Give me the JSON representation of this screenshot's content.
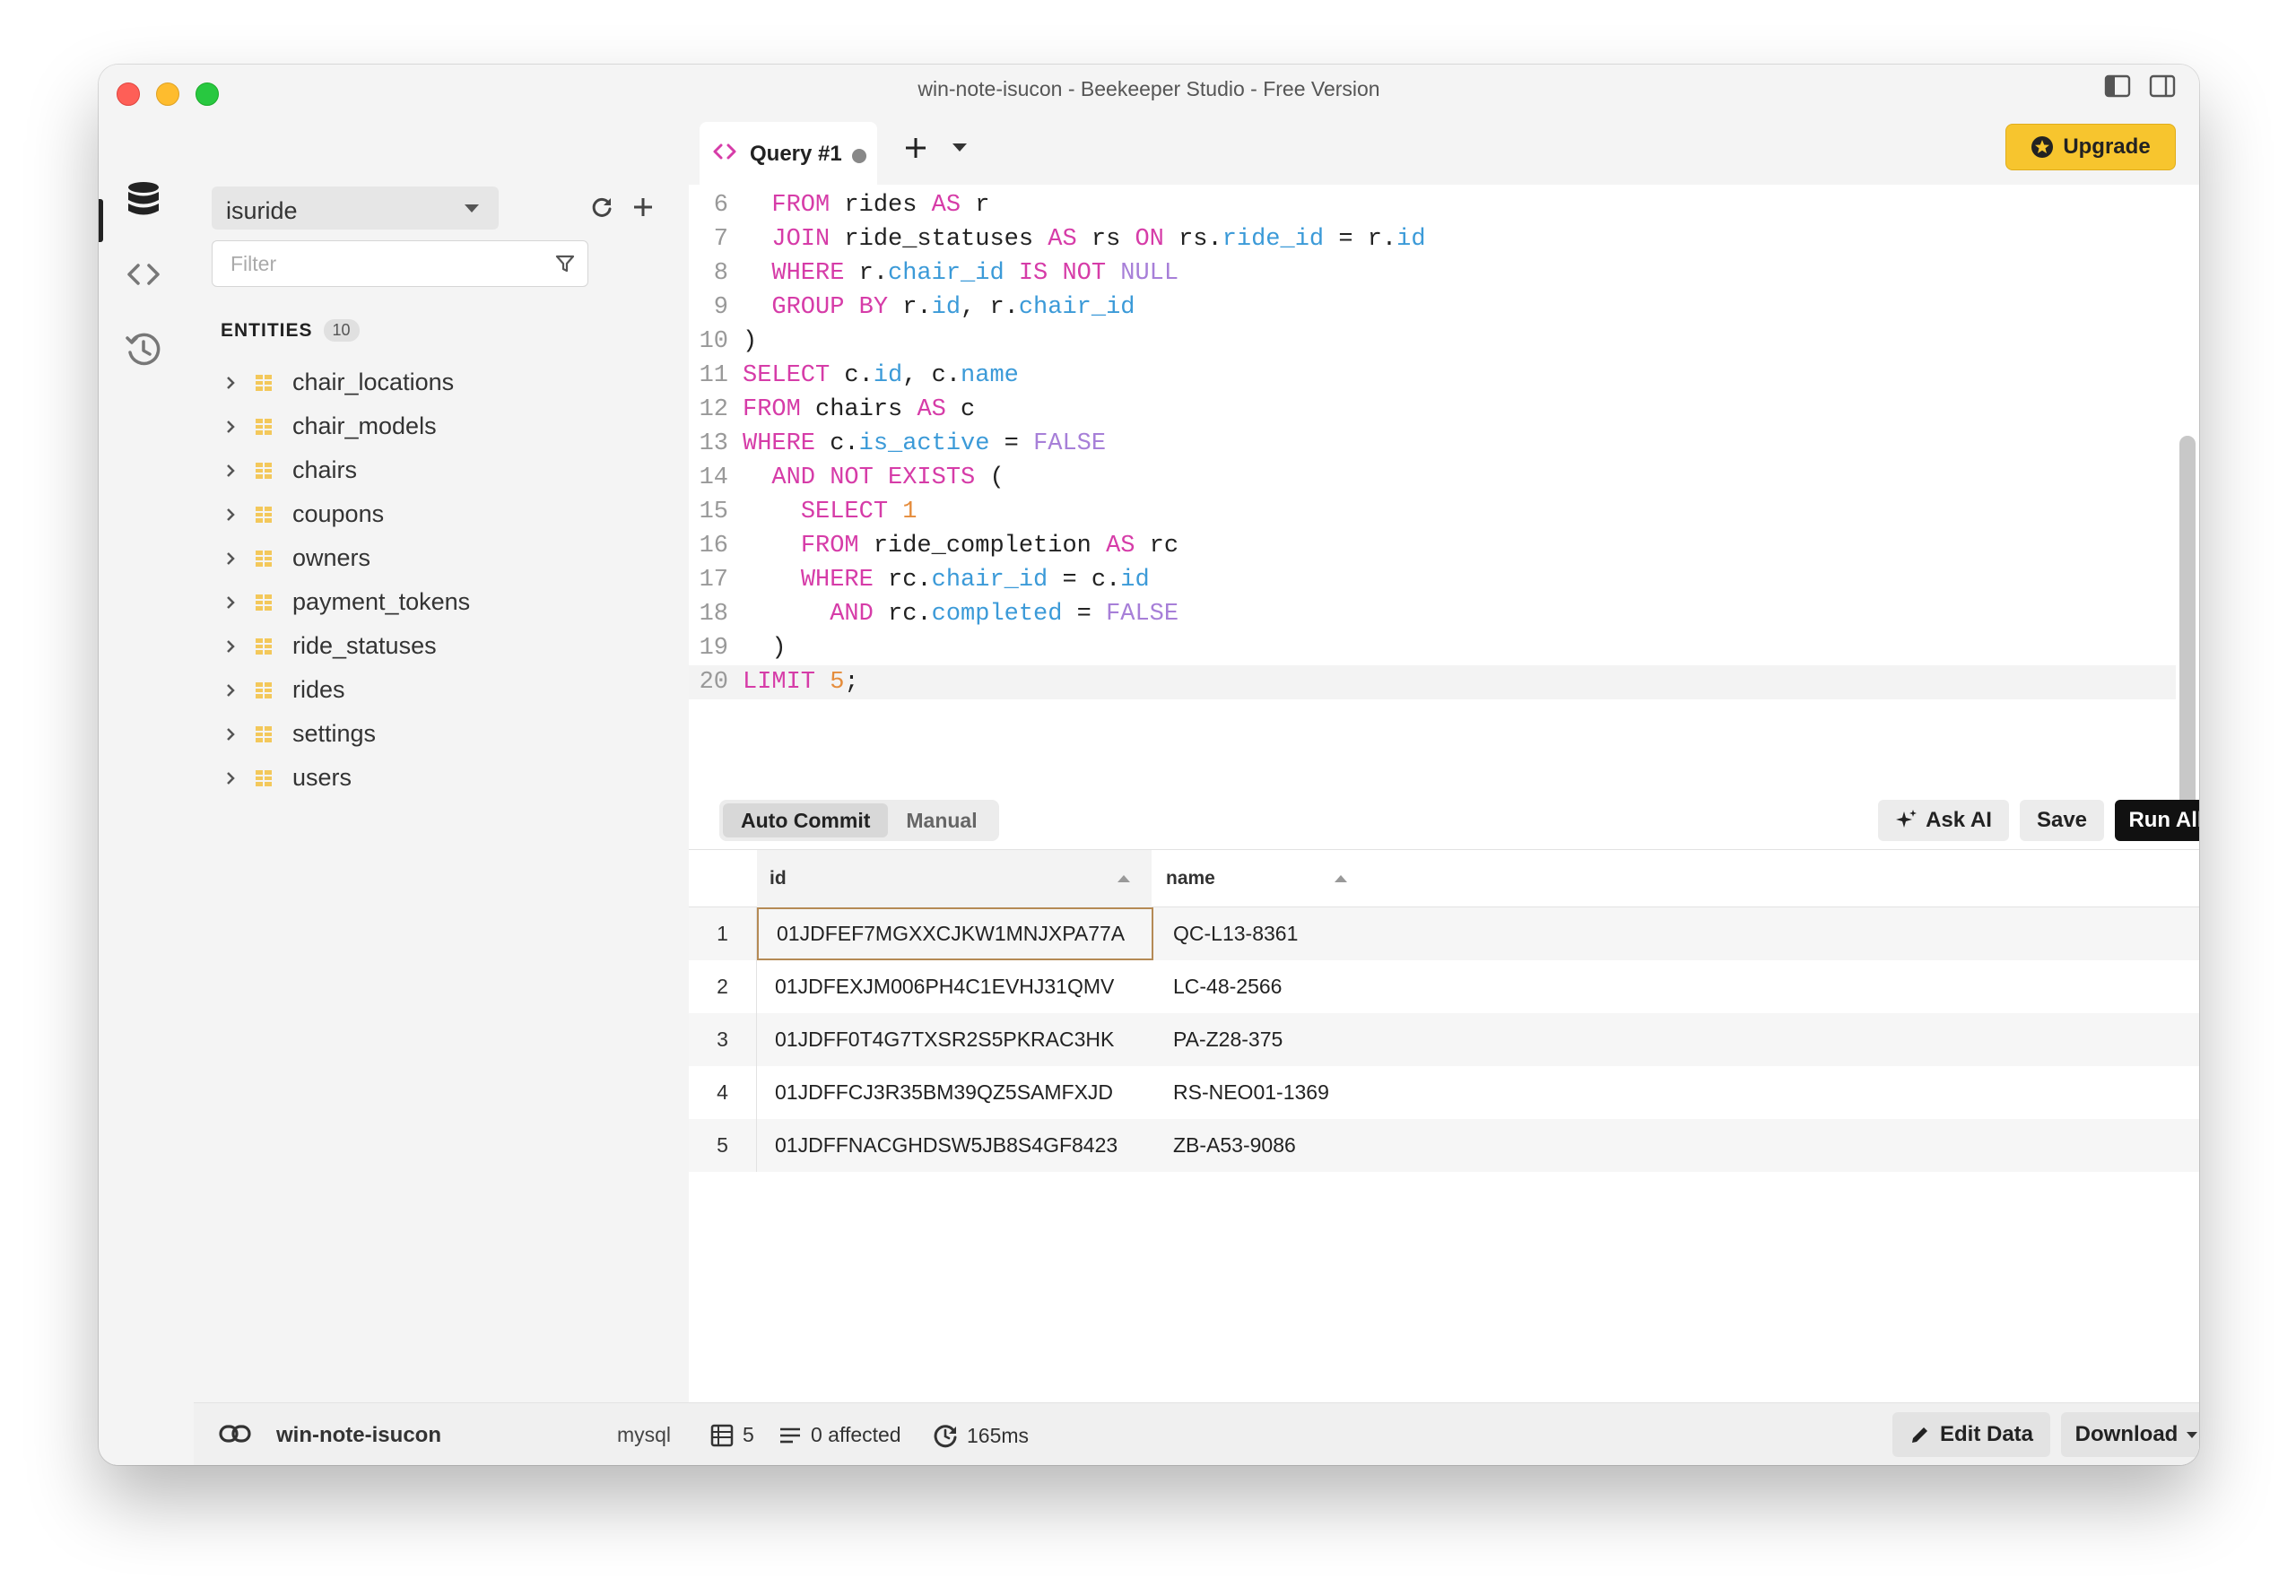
{
  "window": {
    "title": "win-note-isucon - Beekeeper Studio - Free Version"
  },
  "sidebar": {
    "database": "isuride",
    "filter_placeholder": "Filter",
    "entities_label": "ENTITIES",
    "entities_count": "10",
    "entities": [
      "chair_locations",
      "chair_models",
      "chairs",
      "coupons",
      "owners",
      "payment_tokens",
      "ride_statuses",
      "rides",
      "settings",
      "users"
    ],
    "connection_name": "win-note-isucon",
    "dialect": "mysql"
  },
  "tabs": {
    "active": "Query #1"
  },
  "upgrade_label": "Upgrade",
  "editor": {
    "line_numbers": [
      "6",
      "7",
      "8",
      "9",
      "10",
      "11",
      "12",
      "13",
      "14",
      "15",
      "16",
      "17",
      "18",
      "19",
      "20"
    ]
  },
  "toolbar": {
    "auto_commit": "Auto Commit",
    "manual": "Manual",
    "ask_ai": "Ask AI",
    "save": "Save",
    "run_all": "Run All"
  },
  "results": {
    "columns": [
      "id",
      "name"
    ],
    "rows": [
      {
        "num": "1",
        "id": "01JDFEF7MGXXCJKW1MNJXPA77A",
        "name": "QC-L13-8361"
      },
      {
        "num": "2",
        "id": "01JDFEXJM006PH4C1EVHJ31QMV",
        "name": "LC-48-2566"
      },
      {
        "num": "3",
        "id": "01JDFF0T4G7TXSR2S5PKRAC3HK",
        "name": "PA-Z28-375"
      },
      {
        "num": "4",
        "id": "01JDFFCJ3R35BM39QZ5SAMFXJD",
        "name": "RS-NEO01-1369"
      },
      {
        "num": "5",
        "id": "01JDFFNACGHDSW5JB8S4GF8423",
        "name": "ZB-A53-9086"
      }
    ]
  },
  "status": {
    "rows": "5",
    "affected": "0 affected",
    "duration": "165ms",
    "edit_data": "Edit Data",
    "download": "Download"
  },
  "colors": {
    "keyword": "#d63ca8",
    "field": "#3b9ad8",
    "literal": "#a77fd8",
    "number": "#e58c3b",
    "upgrade": "#f7c52e"
  }
}
